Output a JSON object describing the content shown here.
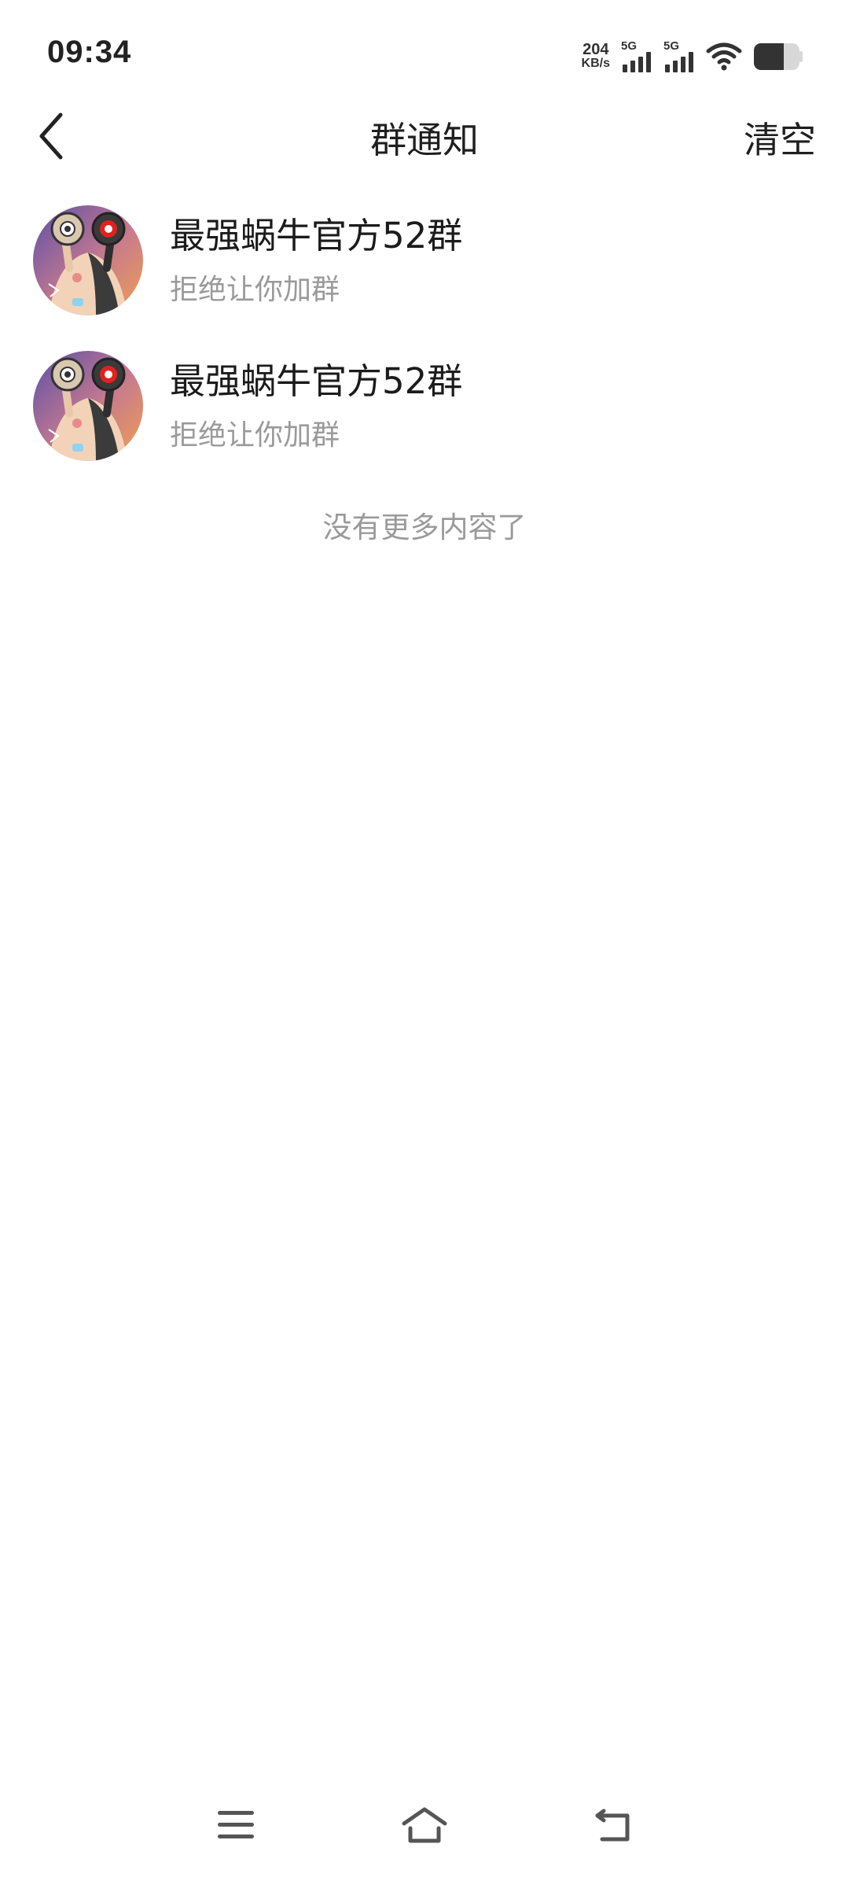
{
  "status_bar": {
    "time": "09:34",
    "net_speed_value": "204",
    "net_speed_unit": "KB/s",
    "sim1_type": "5G",
    "sim2_type": "5G",
    "icons": [
      "signal-icon",
      "signal-icon",
      "wifi-icon",
      "battery-icon"
    ]
  },
  "header": {
    "title": "群通知",
    "clear_label": "清空",
    "back_icon": "back-icon"
  },
  "notifications": [
    {
      "group_name": "最强蜗牛官方52群",
      "status": "拒绝让你加群"
    },
    {
      "group_name": "最强蜗牛官方52群",
      "status": "拒绝让你加群"
    }
  ],
  "footer_text": "没有更多内容了",
  "nav": {
    "icons": [
      "menu-icon",
      "home-icon",
      "back-nav-icon"
    ]
  },
  "colors": {
    "text_primary": "#1f1f1f",
    "text_secondary": "#9a9a9a",
    "background": "#ffffff"
  }
}
